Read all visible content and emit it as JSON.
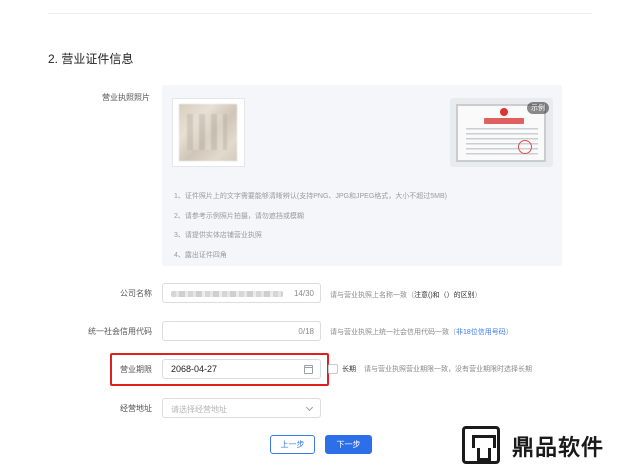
{
  "section": {
    "title": "2. 营业证件信息"
  },
  "license_photo": {
    "label": "营业执照照片",
    "example_badge": "示例",
    "example_doc_title": "营业执照",
    "tips": [
      "1、证件照片上的文字需要能够清晰辨认(支持PNG、JPG和JPEG格式，大小不超过5MB)",
      "2、请参考示例照片拍摄，请勿遮挡或模糊",
      "3、请提供实体店铺营业执照",
      "4、露出证件四角"
    ]
  },
  "company_name": {
    "label": "公司名称",
    "counter": "14/30",
    "hint_prefix": "请与营业执照上名称一致（",
    "hint_strong": "注意()和（）的区别",
    "hint_suffix": "）"
  },
  "credit_code": {
    "label": "统一社会信用代码",
    "counter": "0/18",
    "hint_prefix": "请与营业执照上统一社会信用代码一致（",
    "hint_link": "非18位信用号码",
    "hint_suffix": "）"
  },
  "business_term": {
    "label": "营业期限",
    "value": "2068-04-27",
    "long_term_label": "长期",
    "hint": "请与营业执照营业期限一致，没有营业期限时选择长期"
  },
  "business_address": {
    "label": "经营地址",
    "placeholder": "请选择经营地址"
  },
  "buttons": {
    "prev": "上一步",
    "next": "下一步"
  },
  "watermark": {
    "text": "鼎品软件"
  },
  "colors": {
    "accent": "#2d6fe8",
    "highlight": "#e02020",
    "example_stamp": "#e05050"
  }
}
